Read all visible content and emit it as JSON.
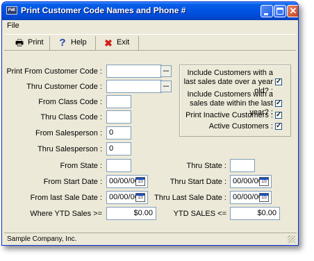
{
  "window": {
    "title": "Print Customer Code Names and Phone #",
    "app_icon_text": "FWE"
  },
  "menu": {
    "file": "File"
  },
  "toolbar": {
    "print": "Print",
    "help": "Help",
    "exit": "Exit"
  },
  "form": {
    "print_from_customer_code": {
      "label": "Print From Customer Code :",
      "value": ""
    },
    "thru_customer_code": {
      "label": "Thru Customer Code :",
      "value": ""
    },
    "from_class_code": {
      "label": "From Class Code :",
      "value": ""
    },
    "thru_class_code": {
      "label": "Thru Class Code :",
      "value": ""
    },
    "from_salesperson": {
      "label": "From Salesperson :",
      "value": "0"
    },
    "thru_salesperson": {
      "label": "Thru Salesperson :",
      "value": "0"
    },
    "from_state": {
      "label": "From State :",
      "value": ""
    },
    "thru_state": {
      "label": "Thru State :",
      "value": ""
    },
    "from_start_date": {
      "label": "From Start Date :",
      "value": "00/00/00"
    },
    "thru_start_date": {
      "label": "Thru Start Date :",
      "value": "00/00/00"
    },
    "from_last_sale_date": {
      "label": "From last Sale Date :",
      "value": "00/00/00"
    },
    "thru_last_sale_date": {
      "label": "Thru Last Sale Date :",
      "value": "00/00/00"
    },
    "where_ytd_sales": {
      "label": "Where YTD Sales >=",
      "value": "$0.00"
    },
    "ytd_sales_max": {
      "label": "YTD SALES <=",
      "value": "$0.00"
    }
  },
  "options": {
    "over_year_old": {
      "label": "Include Customers with a last sales date over a year old? :",
      "checked": true
    },
    "within_last_year": {
      "label": "Include Customers with a sales date within the last year? :",
      "checked": true
    },
    "print_inactive": {
      "label": "Print Inactive Customers :",
      "checked": true
    },
    "active_customers": {
      "label": "Active Customers :",
      "checked": true
    }
  },
  "icons": {
    "ellipsis": "...",
    "calendar": "15",
    "checkmark": "✓"
  },
  "status": {
    "text": "Sample Company, Inc."
  }
}
